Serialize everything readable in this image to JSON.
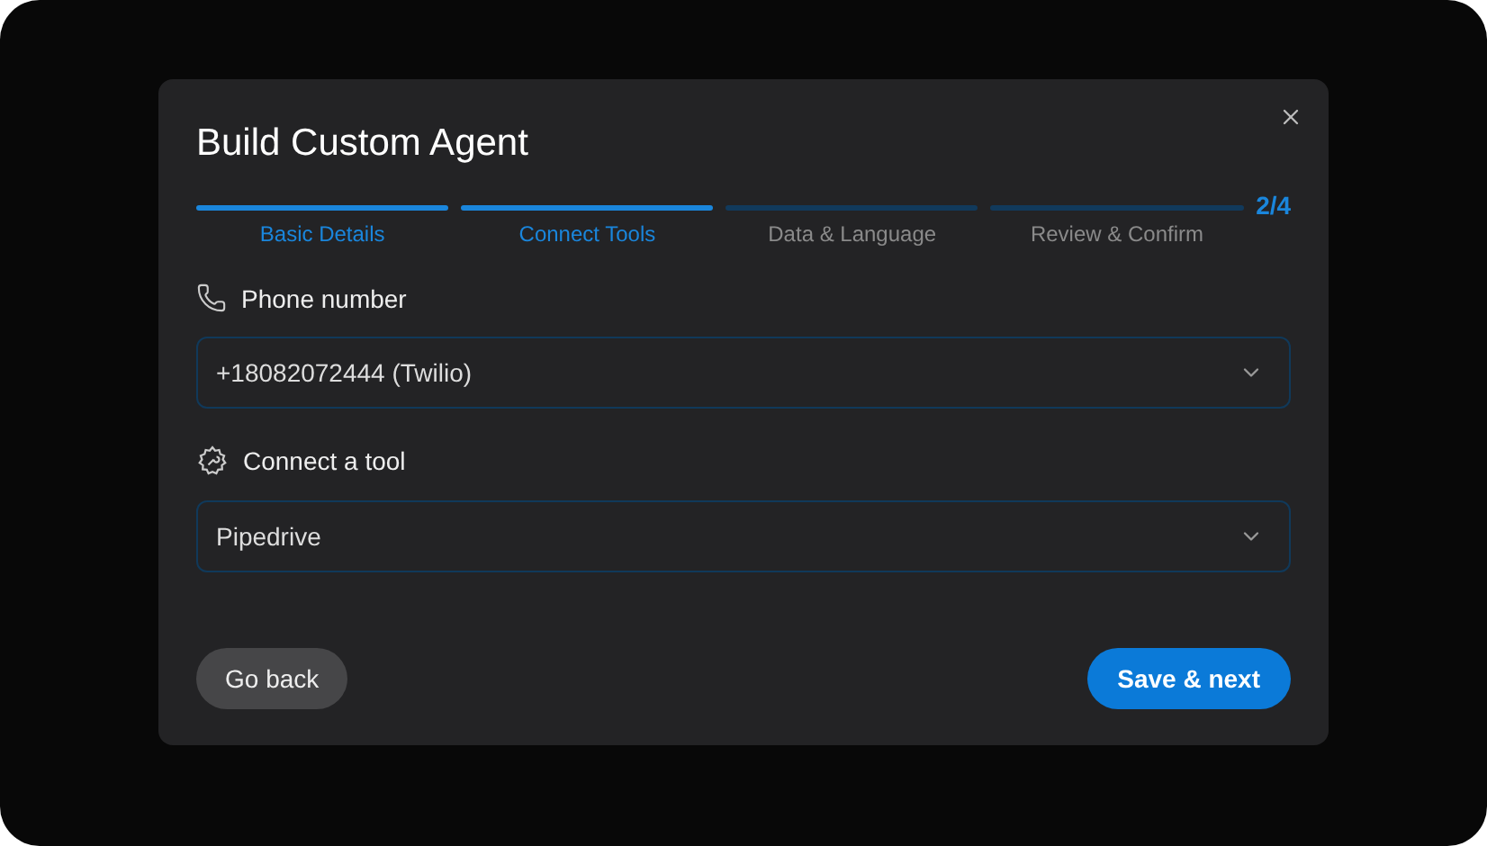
{
  "dialog": {
    "title": "Build Custom Agent"
  },
  "steps": [
    {
      "label": "Basic Details",
      "completed": true
    },
    {
      "label": "Connect Tools",
      "completed": true
    },
    {
      "label": "Data & Language",
      "completed": false
    },
    {
      "label": "Review & Confirm",
      "completed": false
    }
  ],
  "step_counter": "2/4",
  "fields": [
    {
      "kind": "phone",
      "label": "Phone number",
      "value": "+18082072444 (Twilio)"
    },
    {
      "kind": "tool",
      "label": "Connect a tool",
      "value": "Pipedrive"
    }
  ],
  "buttons": {
    "back": "Go back",
    "next": "Save & next"
  }
}
